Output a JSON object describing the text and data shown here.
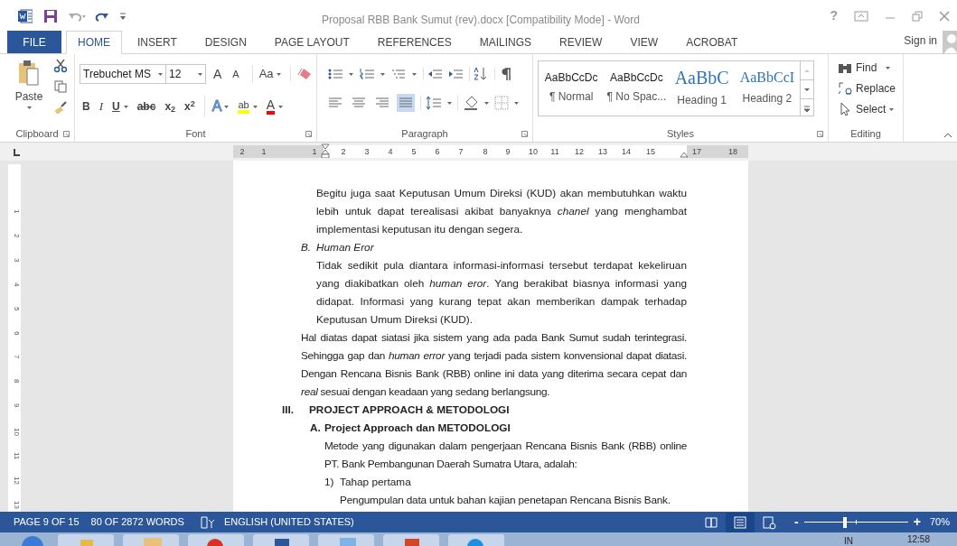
{
  "window": {
    "title": "Proposal RBB Bank Sumut (rev).docx [Compatibility Mode] - Word",
    "help": "?"
  },
  "tabs": [
    {
      "label": "FILE",
      "kind": "file",
      "selected": false
    },
    {
      "label": "HOME",
      "kind": "tab",
      "selected": true
    },
    {
      "label": "INSERT",
      "kind": "tab",
      "selected": false
    },
    {
      "label": "DESIGN",
      "kind": "tab",
      "selected": false
    },
    {
      "label": "PAGE LAYOUT",
      "kind": "tab",
      "selected": false
    },
    {
      "label": "REFERENCES",
      "kind": "tab",
      "selected": false
    },
    {
      "label": "MAILINGS",
      "kind": "tab",
      "selected": false
    },
    {
      "label": "REVIEW",
      "kind": "tab",
      "selected": false
    },
    {
      "label": "VIEW",
      "kind": "tab",
      "selected": false
    },
    {
      "label": "ACROBAT",
      "kind": "tab",
      "selected": false
    }
  ],
  "sign_in": "Sign in",
  "ribbon": {
    "clipboard": {
      "label": "Clipboard",
      "paste": "Paste"
    },
    "font": {
      "label": "Font",
      "font_name": "Trebuchet MS",
      "font_size": "12",
      "grow": "A",
      "shrink": "A",
      "change_case": "Aa",
      "format_buttons": [
        {
          "kind": "bold",
          "label": "B"
        },
        {
          "kind": "italic",
          "label": "I"
        },
        {
          "kind": "underline",
          "label": "U"
        },
        {
          "kind": "strike",
          "label": "abc"
        },
        {
          "kind": "sub",
          "label": "x$_{2}$"
        },
        {
          "kind": "sup",
          "label": "x$^{2}$"
        }
      ],
      "effects": "A",
      "highlight": "ab",
      "font_color": "A"
    },
    "paragraph": {
      "label": "Paragraph",
      "alignments": [
        {
          "kind": "left",
          "selected": false
        },
        {
          "kind": "center",
          "selected": false
        },
        {
          "kind": "right",
          "selected": false
        },
        {
          "kind": "justify",
          "selected": true
        }
      ]
    },
    "styles": {
      "label": "Styles",
      "items": [
        {
          "sample": "AaBbCcDc",
          "name": "¶ Normal",
          "kind": "body"
        },
        {
          "sample": "AaBbCcDc",
          "name": "¶ No Spac...",
          "kind": "body"
        },
        {
          "sample": "AaBbC",
          "name": "Heading 1",
          "kind": "h1"
        },
        {
          "sample": "AaBbCcI",
          "name": "Heading 2",
          "kind": "h2"
        }
      ]
    },
    "editing": {
      "label": "Editing",
      "find": "Find",
      "replace": "Replace",
      "select": "Select"
    }
  },
  "ruler": {
    "marks": [
      "2",
      "1",
      "1",
      "2",
      "3",
      "4",
      "5",
      "6",
      "7",
      "8",
      "9",
      "10",
      "11",
      "12",
      "13",
      "14",
      "15",
      "17",
      "18"
    ]
  },
  "vertical_ruler": {
    "marks": [
      "1",
      "2",
      "3",
      "4",
      "5",
      "6",
      "7",
      "8",
      "9",
      "10",
      "11",
      "12",
      "13"
    ]
  },
  "document": [
    {
      "kind": "para",
      "text": "Begitu juga saat Keputusan Umum Direksi (KUD) akan membutuhkan waktu lebih untuk dapat terealisasi akibat banyaknya *chanel* yang menghambat implementasi keputusan itu dengan segera."
    },
    {
      "kind": "list_item",
      "marker": "B.",
      "text": "Human Eror"
    },
    {
      "kind": "para",
      "text": "Tidak sedikit pula diantara informasi-informasi tersebut terdapat kekeliruan yang diakibatkan oleh *human eror*. Yang berakibat biasnya informasi yang didapat. Informasi yang kurang tepat akan memberikan dampak terhadap Keputusan Umum Direksi (KUD)."
    },
    {
      "kind": "body_para",
      "text": "Hal diatas dapat siatasi jika sistem yang ada pada Bank Sumut sudah terintegrasi. Sehingga gap dan *human error* yang terjadi pada sistem konvensional dapat diatasi. Dengan Rencana Bisnis Bank (RBB) online ini data yang diterima secara cepat dan *real* sesuai dengan keadaan yang sedang berlangsung."
    },
    {
      "kind": "section_heading",
      "marker": "III.",
      "text": "PROJECT APPROACH & METODOLOGI"
    },
    {
      "kind": "subsection_heading",
      "marker": "A.",
      "text": "Project Approach dan METODOLOGI"
    },
    {
      "kind": "sub_para",
      "text": "Metode yang digunakan dalam pengerjaan Rencana Bisnis Bank (RBB) online PT. Bank Pembangunan Daerah Sumatra Utara, adalah:"
    },
    {
      "kind": "step",
      "marker": "1)",
      "text": "Tahap pertama"
    },
    {
      "kind": "step_para",
      "text": "Pengumpulan data untuk bahan kajian penetapan Rencana Bisnis Bank."
    }
  ],
  "status_bar": {
    "page": "PAGE 9 OF 15",
    "words": "80 OF 2872 WORDS",
    "language": "ENGLISH (UNITED STATES)",
    "views": [
      {
        "kind": "read",
        "selected": false
      },
      {
        "kind": "print",
        "selected": true
      },
      {
        "kind": "web",
        "selected": false
      }
    ],
    "zoom_out": "-",
    "zoom_in": "+",
    "zoom": {
      "level": 0.39
    },
    "zoom_label": "70%"
  },
  "taskbar": {
    "apps": [
      {
        "kind": "orb"
      },
      {
        "kind": "folder"
      },
      {
        "kind": "explorer"
      },
      {
        "kind": "chrome"
      },
      {
        "kind": "word"
      },
      {
        "kind": "window"
      },
      {
        "kind": "powerpoint"
      },
      {
        "kind": "teamviewer"
      }
    ],
    "language": "IN",
    "time": "12:58"
  }
}
